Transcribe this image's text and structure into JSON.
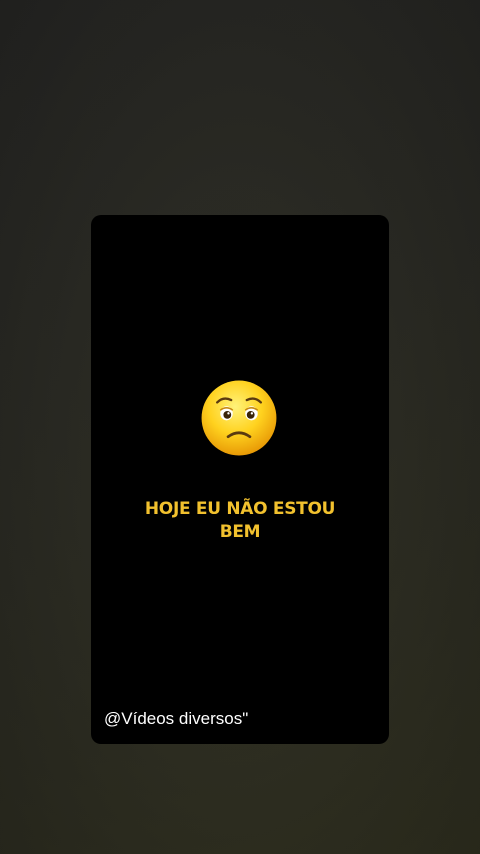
{
  "video": {
    "emoji": "worried-face-icon",
    "message_line1": "HOJE EU NÃO ESTOU",
    "message_line2": "BEM",
    "watermark": "@Vídeos diversos\"",
    "text_color": "#f2c12e",
    "card_color": "#000000"
  }
}
